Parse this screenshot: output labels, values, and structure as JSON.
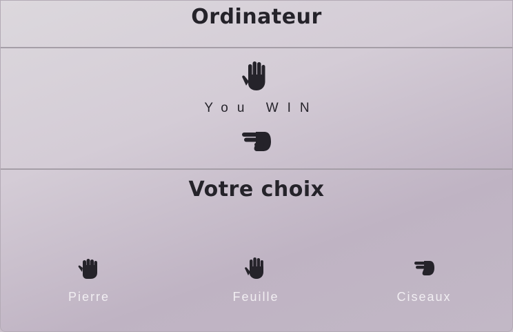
{
  "computer": {
    "title": "Ordinateur",
    "hand_icon": "paper-hand-icon"
  },
  "result": {
    "text": "You WIN"
  },
  "player": {
    "hand_icon": "scissors-hand-icon"
  },
  "choices_section": {
    "title": "Votre choix"
  },
  "choices": [
    {
      "label": "Pierre",
      "icon": "rock-fist-icon"
    },
    {
      "label": "Feuille",
      "icon": "paper-hand-icon"
    },
    {
      "label": "Ciseaux",
      "icon": "scissors-hand-icon"
    }
  ],
  "colors": {
    "icon": "#25232a",
    "label": "#f1eef2",
    "divider": "#a59ea7"
  }
}
